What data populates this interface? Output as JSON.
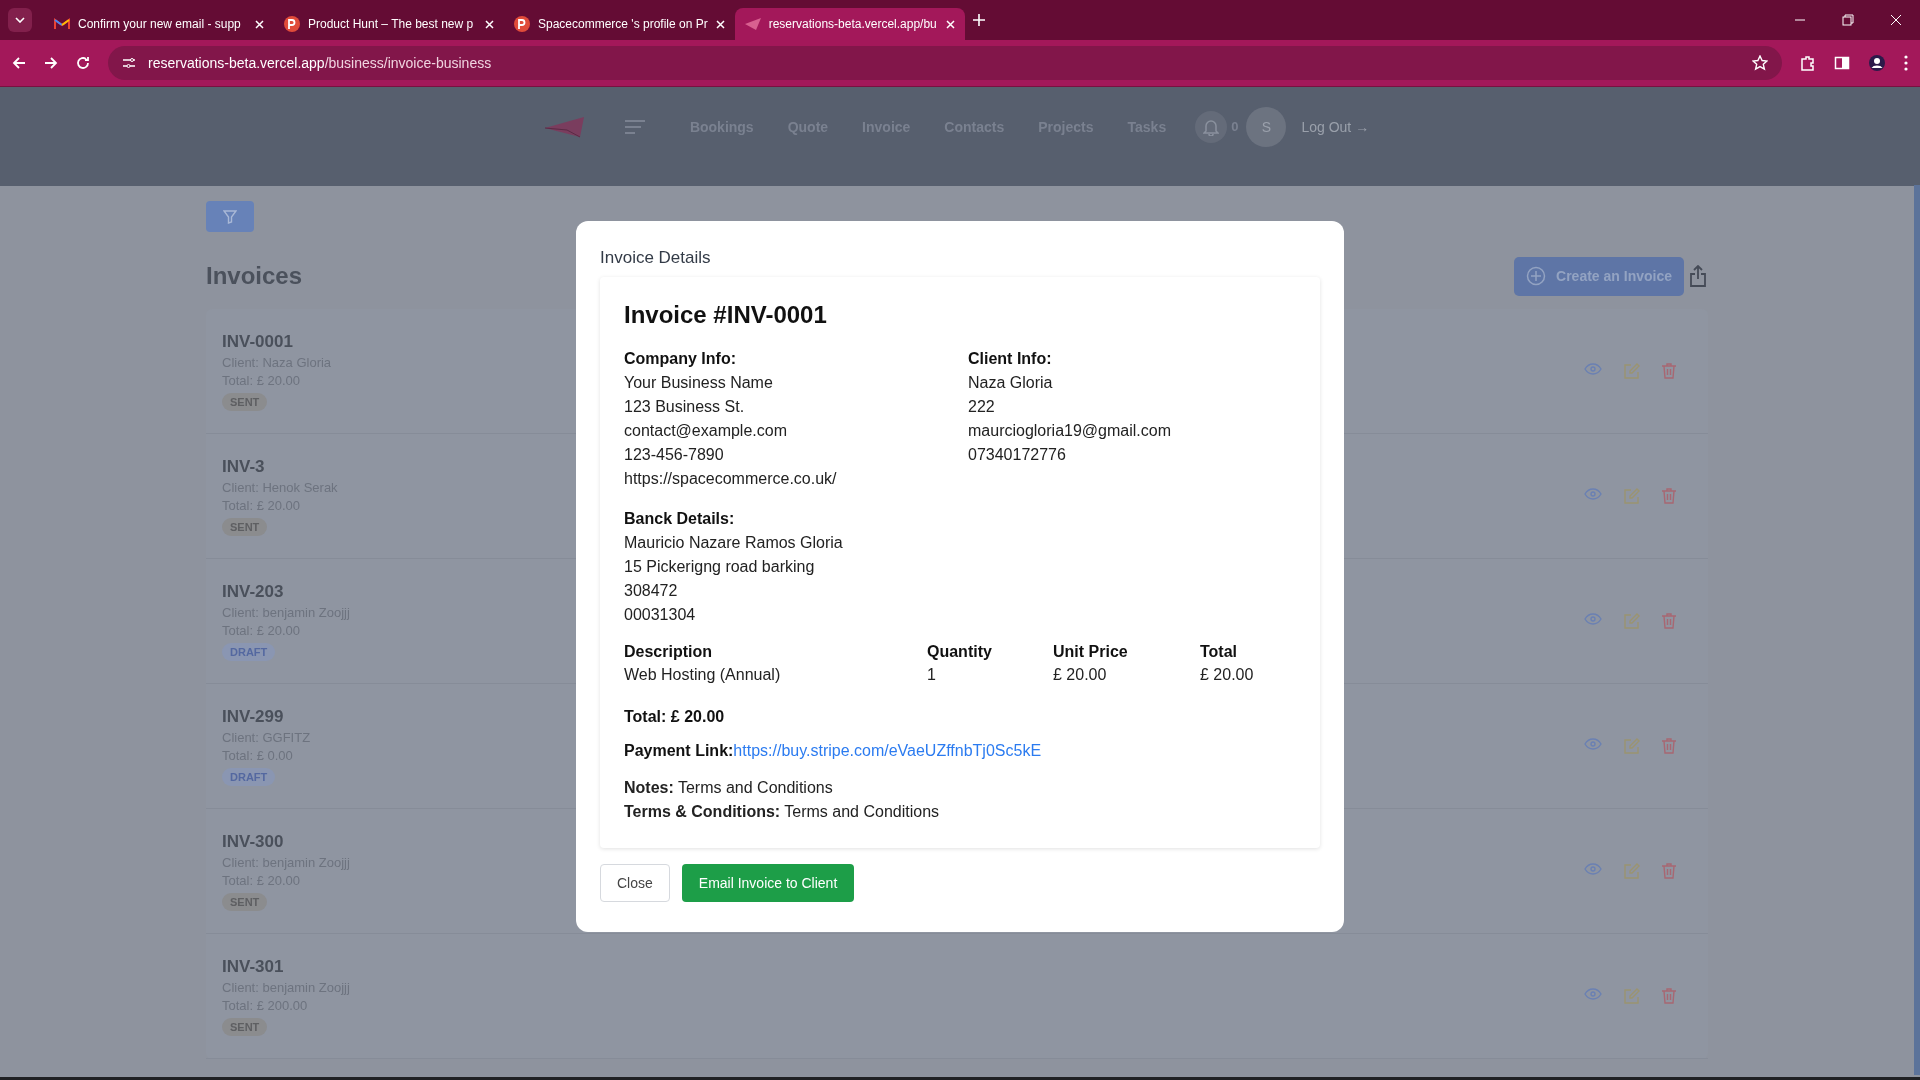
{
  "browser": {
    "tabs": [
      {
        "title": "Confirm your new email - supp",
        "kind": "mail",
        "selected": false
      },
      {
        "title": "Product Hunt – The best new p",
        "kind": "p",
        "selected": false
      },
      {
        "title": "Spacecommerce 's profile on Pr",
        "kind": "p",
        "selected": false
      },
      {
        "title": "reservations-beta.vercel.app/bu",
        "kind": "plane",
        "selected": true
      }
    ],
    "address": {
      "host": "reservations-beta.vercel.app",
      "path": "/business/invoice-business"
    }
  },
  "nav": {
    "items": [
      "Bookings",
      "Quote",
      "Invoice",
      "Contacts",
      "Projects",
      "Tasks"
    ],
    "notification_count": "0",
    "avatar_initial": "S",
    "logout": "Log Out →"
  },
  "page": {
    "title": "Invoices",
    "create_button": "Create an Invoice",
    "invoices": [
      {
        "number": "INV-0001",
        "client": "Client: Naza Gloria",
        "total": "Total: £ 20.00",
        "status": "SENT",
        "kind": "sent"
      },
      {
        "number": "INV-3",
        "client": "Client: Henok Serak",
        "total": "Total: £ 20.00",
        "status": "SENT",
        "kind": "sent"
      },
      {
        "number": "INV-203",
        "client": "Client: benjamin Zoojjj",
        "total": "Total: £ 20.00",
        "status": "DRAFT",
        "kind": "draft"
      },
      {
        "number": "INV-299",
        "client": "Client: GGFITZ",
        "total": "Total: £ 0.00",
        "status": "DRAFT",
        "kind": "draft"
      },
      {
        "number": "INV-300",
        "client": "Client: benjamin Zoojjj",
        "total": "Total: £ 20.00",
        "status": "SENT",
        "kind": "sent"
      },
      {
        "number": "INV-301",
        "client": "Client: benjamin Zoojjj",
        "total": "Total: £ 200.00",
        "status": "SENT",
        "kind": "sent"
      }
    ]
  },
  "modal": {
    "title": "Invoice Details",
    "heading": "Invoice #INV-0001",
    "company": {
      "label": "Company Info:",
      "lines": [
        "Your Business Name",
        "123 Business St.",
        "contact@example.com",
        "123-456-7890",
        "https://spacecommerce.co.uk/"
      ]
    },
    "client": {
      "label": "Client Info:",
      "lines": [
        "Naza Gloria",
        "222",
        "maurciogloria19@gmail.com",
        "07340172776"
      ]
    },
    "bank": {
      "label": "Banck Details:",
      "lines": [
        "Mauricio Nazare Ramos Gloria",
        "15 Pickerigng road barking",
        "308472",
        "00031304"
      ]
    },
    "table": {
      "columns": [
        "Description",
        "Quantity",
        "Unit Price",
        "Total"
      ],
      "rows": [
        [
          "Web Hosting (Annual)",
          "1",
          "£ 20.00",
          "£ 20.00"
        ]
      ]
    },
    "total": "Total: £ 20.00",
    "payment_label": "Payment Link:",
    "payment_link": "https://buy.stripe.com/eVaeUZffnbTj0Sc5kE",
    "notes": "**Notes:** Terms and Conditions",
    "terms": "**Terms & Conditions:** Terms and Conditions",
    "buttons": [
      "Close",
      "Email Invoice to Client"
    ]
  }
}
